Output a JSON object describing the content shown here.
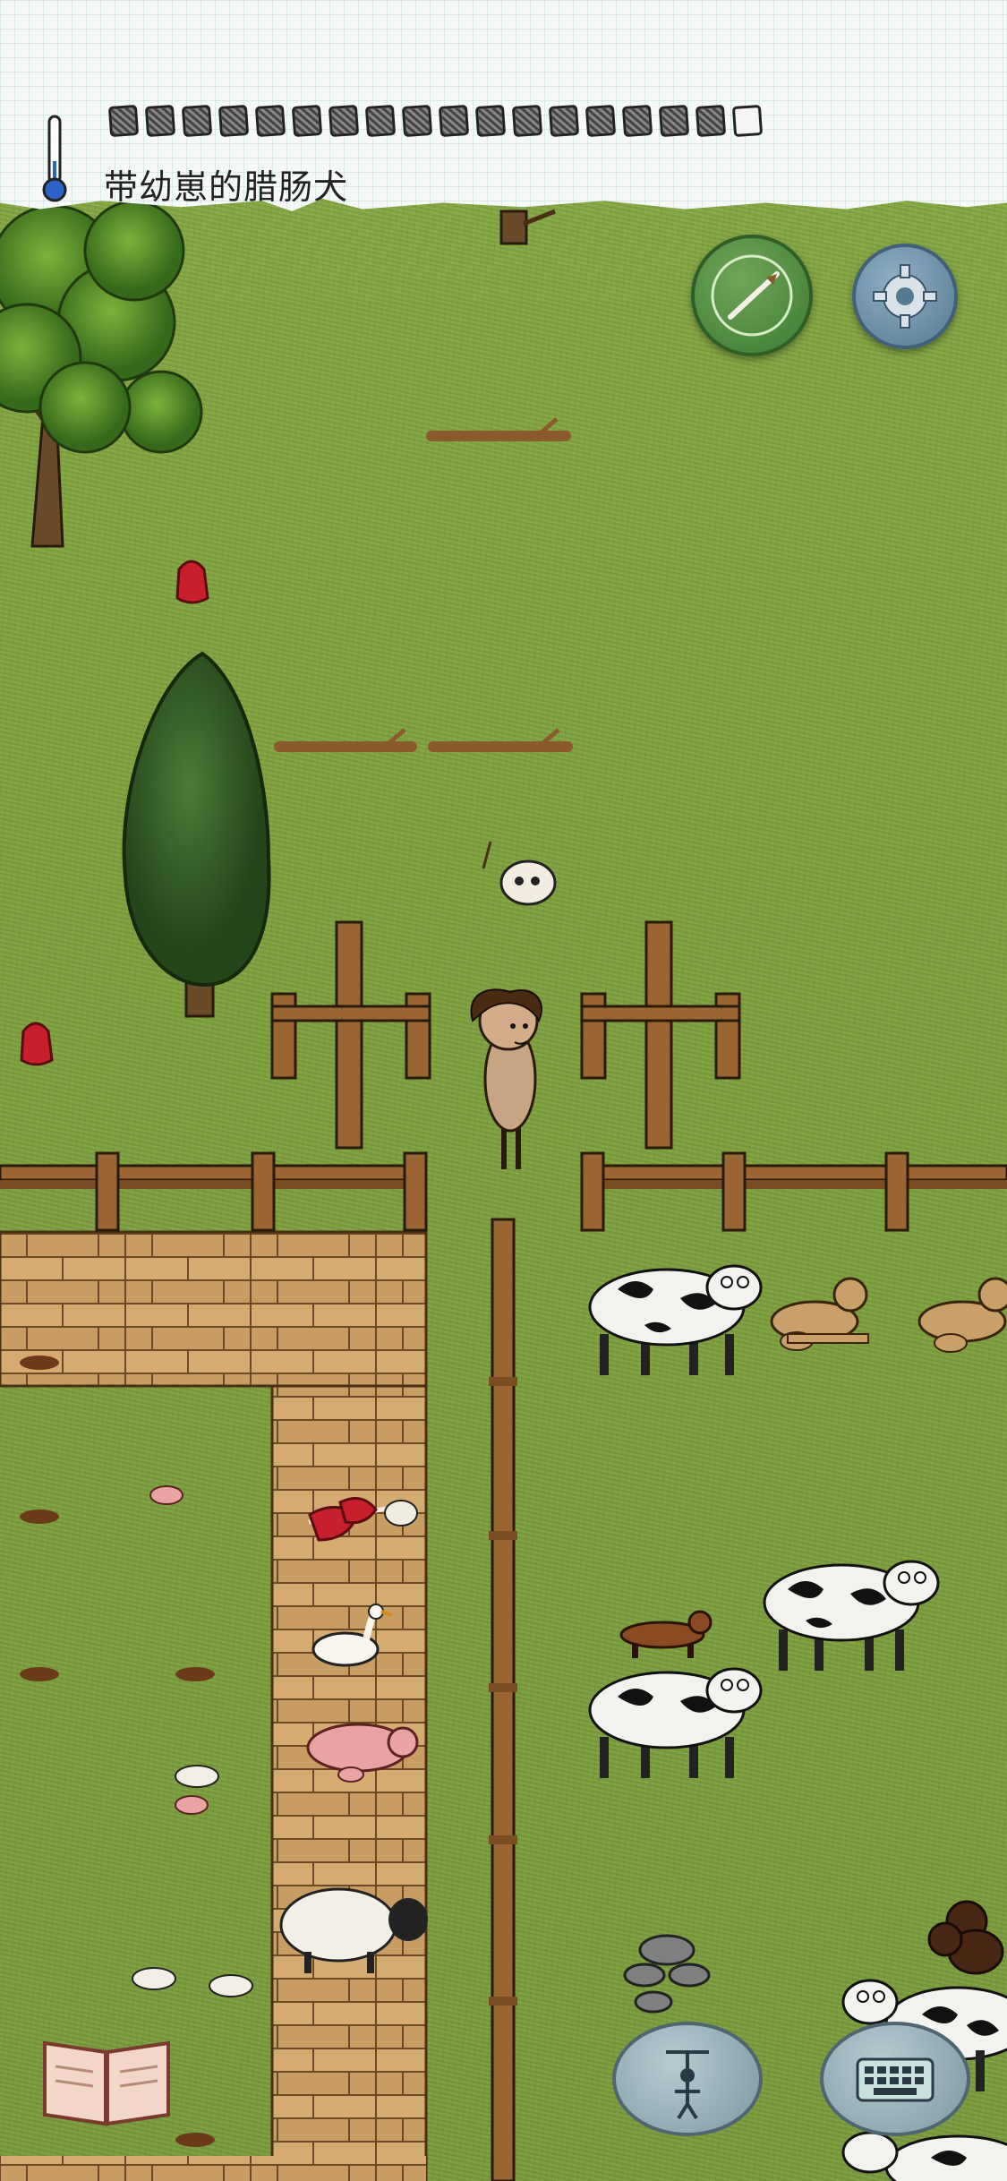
{
  "hud": {
    "status_text": "带幼崽的腊肠犬",
    "temperature_icon": "thermometer-icon",
    "food_pips_total": 18,
    "food_pips_filled": 17
  },
  "buttons": {
    "compass_icon": "compass-icon",
    "settings_icon": "gear-icon",
    "tech_book_icon": "book-icon",
    "emote_icon": "puppet-emote-icon",
    "keyboard_icon": "keyboard-icon"
  },
  "colors": {
    "grass": "#7fa53f",
    "wood": "#8a5a2c",
    "compass": "#3d7a34",
    "settings": "#557a92"
  }
}
